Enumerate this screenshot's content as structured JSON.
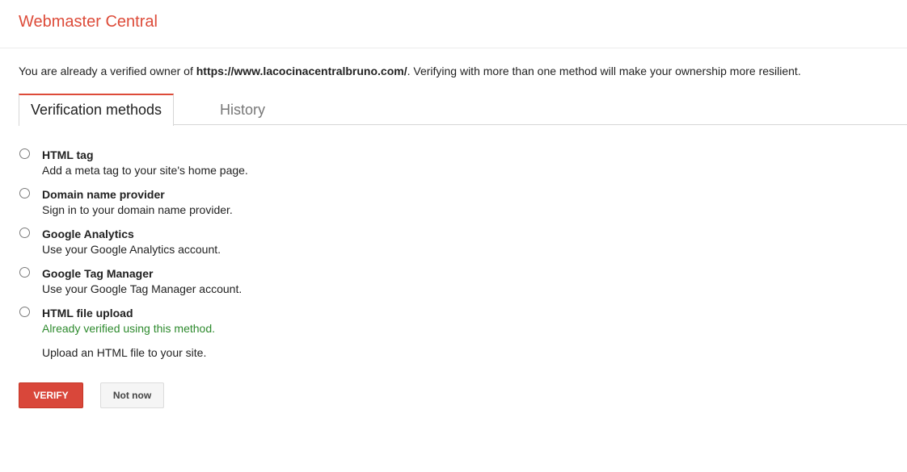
{
  "header": {
    "title": "Webmaster Central"
  },
  "notice": {
    "prefix": "You are already a verified owner of ",
    "site_url": "https://www.lacocinacentralbruno.com/",
    "suffix": ". Verifying with more than one method will make your ownership more resilient."
  },
  "tabs": [
    {
      "label": "Verification methods",
      "active": true
    },
    {
      "label": "History",
      "active": false
    }
  ],
  "methods": [
    {
      "title": "HTML tag",
      "description": "Add a meta tag to your site's home page.",
      "selected": false
    },
    {
      "title": "Domain name provider",
      "description": "Sign in to your domain name provider.",
      "selected": false
    },
    {
      "title": "Google Analytics",
      "description": "Use your Google Analytics account.",
      "selected": false
    },
    {
      "title": "Google Tag Manager",
      "description": "Use your Google Tag Manager account.",
      "selected": false
    },
    {
      "title": "HTML file upload",
      "status": "Already verified using this method.",
      "description": "Upload an HTML file to your site.",
      "selected": false
    }
  ],
  "buttons": {
    "verify_label": "VERIFY",
    "not_now_label": "Not now"
  },
  "colors": {
    "accent": "#dd4b39",
    "verified_status": "#2d8a2d"
  }
}
